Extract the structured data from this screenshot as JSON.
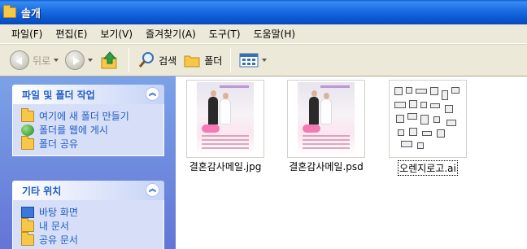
{
  "window": {
    "title": "솔개"
  },
  "menu": [
    "파일(F)",
    "편집(E)",
    "보기(V)",
    "즐겨찾기(A)",
    "도구(T)",
    "도움말(H)"
  ],
  "toolbar": {
    "back_label": "뒤로",
    "search_label": "검색",
    "folders_label": "폴더"
  },
  "file_tasks": {
    "title": "파일 및 폴더 작업",
    "items": [
      "여기에 새 폴더 만들기",
      "폴더를 웹에 게시",
      "폴더 공유"
    ]
  },
  "other_places": {
    "title": "기타 위치",
    "items": [
      "바탕 화면",
      "내 문서",
      "공유 문서"
    ]
  },
  "files": [
    {
      "name": "결혼감사메일.jpg"
    },
    {
      "name": "결혼감사메일.psd"
    },
    {
      "name": "오렌지로고.ai"
    }
  ]
}
